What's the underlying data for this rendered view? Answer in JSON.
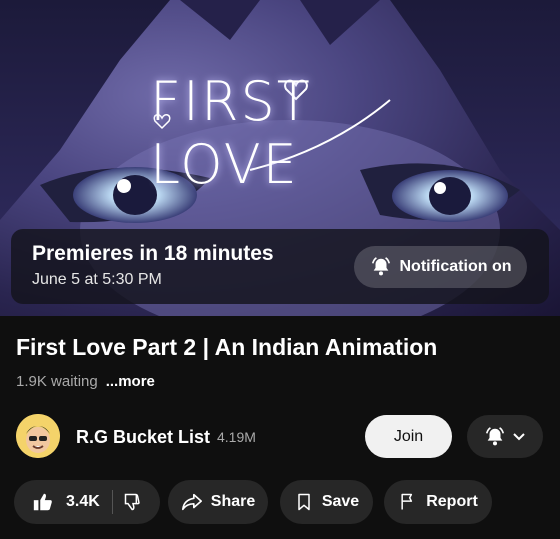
{
  "thumbnail": {
    "art_title": "FIRST LOVE",
    "premiere_title": "Premieres in 18 minutes",
    "premiere_date": "June 5 at 5:30 PM",
    "notification_label": "Notification on"
  },
  "video": {
    "title": "First Love Part 2 | An Indian Animation",
    "waiting": "1.9K waiting",
    "more_label": "...more"
  },
  "channel": {
    "name": "R.G Bucket List",
    "subscribers": "4.19M",
    "join_label": "Join"
  },
  "actions": {
    "like_count": "3.4K",
    "share_label": "Share",
    "save_label": "Save",
    "report_label": "Report"
  },
  "icons": [
    "bell-icon",
    "chevron-down-icon",
    "like-icon",
    "dislike-icon",
    "share-icon",
    "save-icon",
    "report-icon"
  ]
}
